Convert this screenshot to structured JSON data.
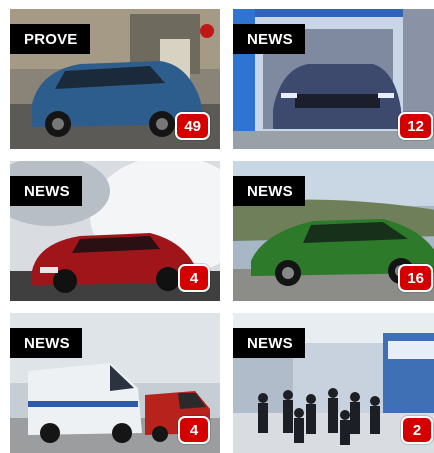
{
  "cards": [
    {
      "tag": "PROVE",
      "comments": "49"
    },
    {
      "tag": "NEWS",
      "comments": "12"
    },
    {
      "tag": "NEWS",
      "comments": "4"
    },
    {
      "tag": "NEWS",
      "comments": "16"
    },
    {
      "tag": "NEWS",
      "comments": "4"
    },
    {
      "tag": "NEWS",
      "comments": "2"
    }
  ],
  "colors": {
    "tag_bg": "#000000",
    "badge_bg": "#d40000"
  }
}
